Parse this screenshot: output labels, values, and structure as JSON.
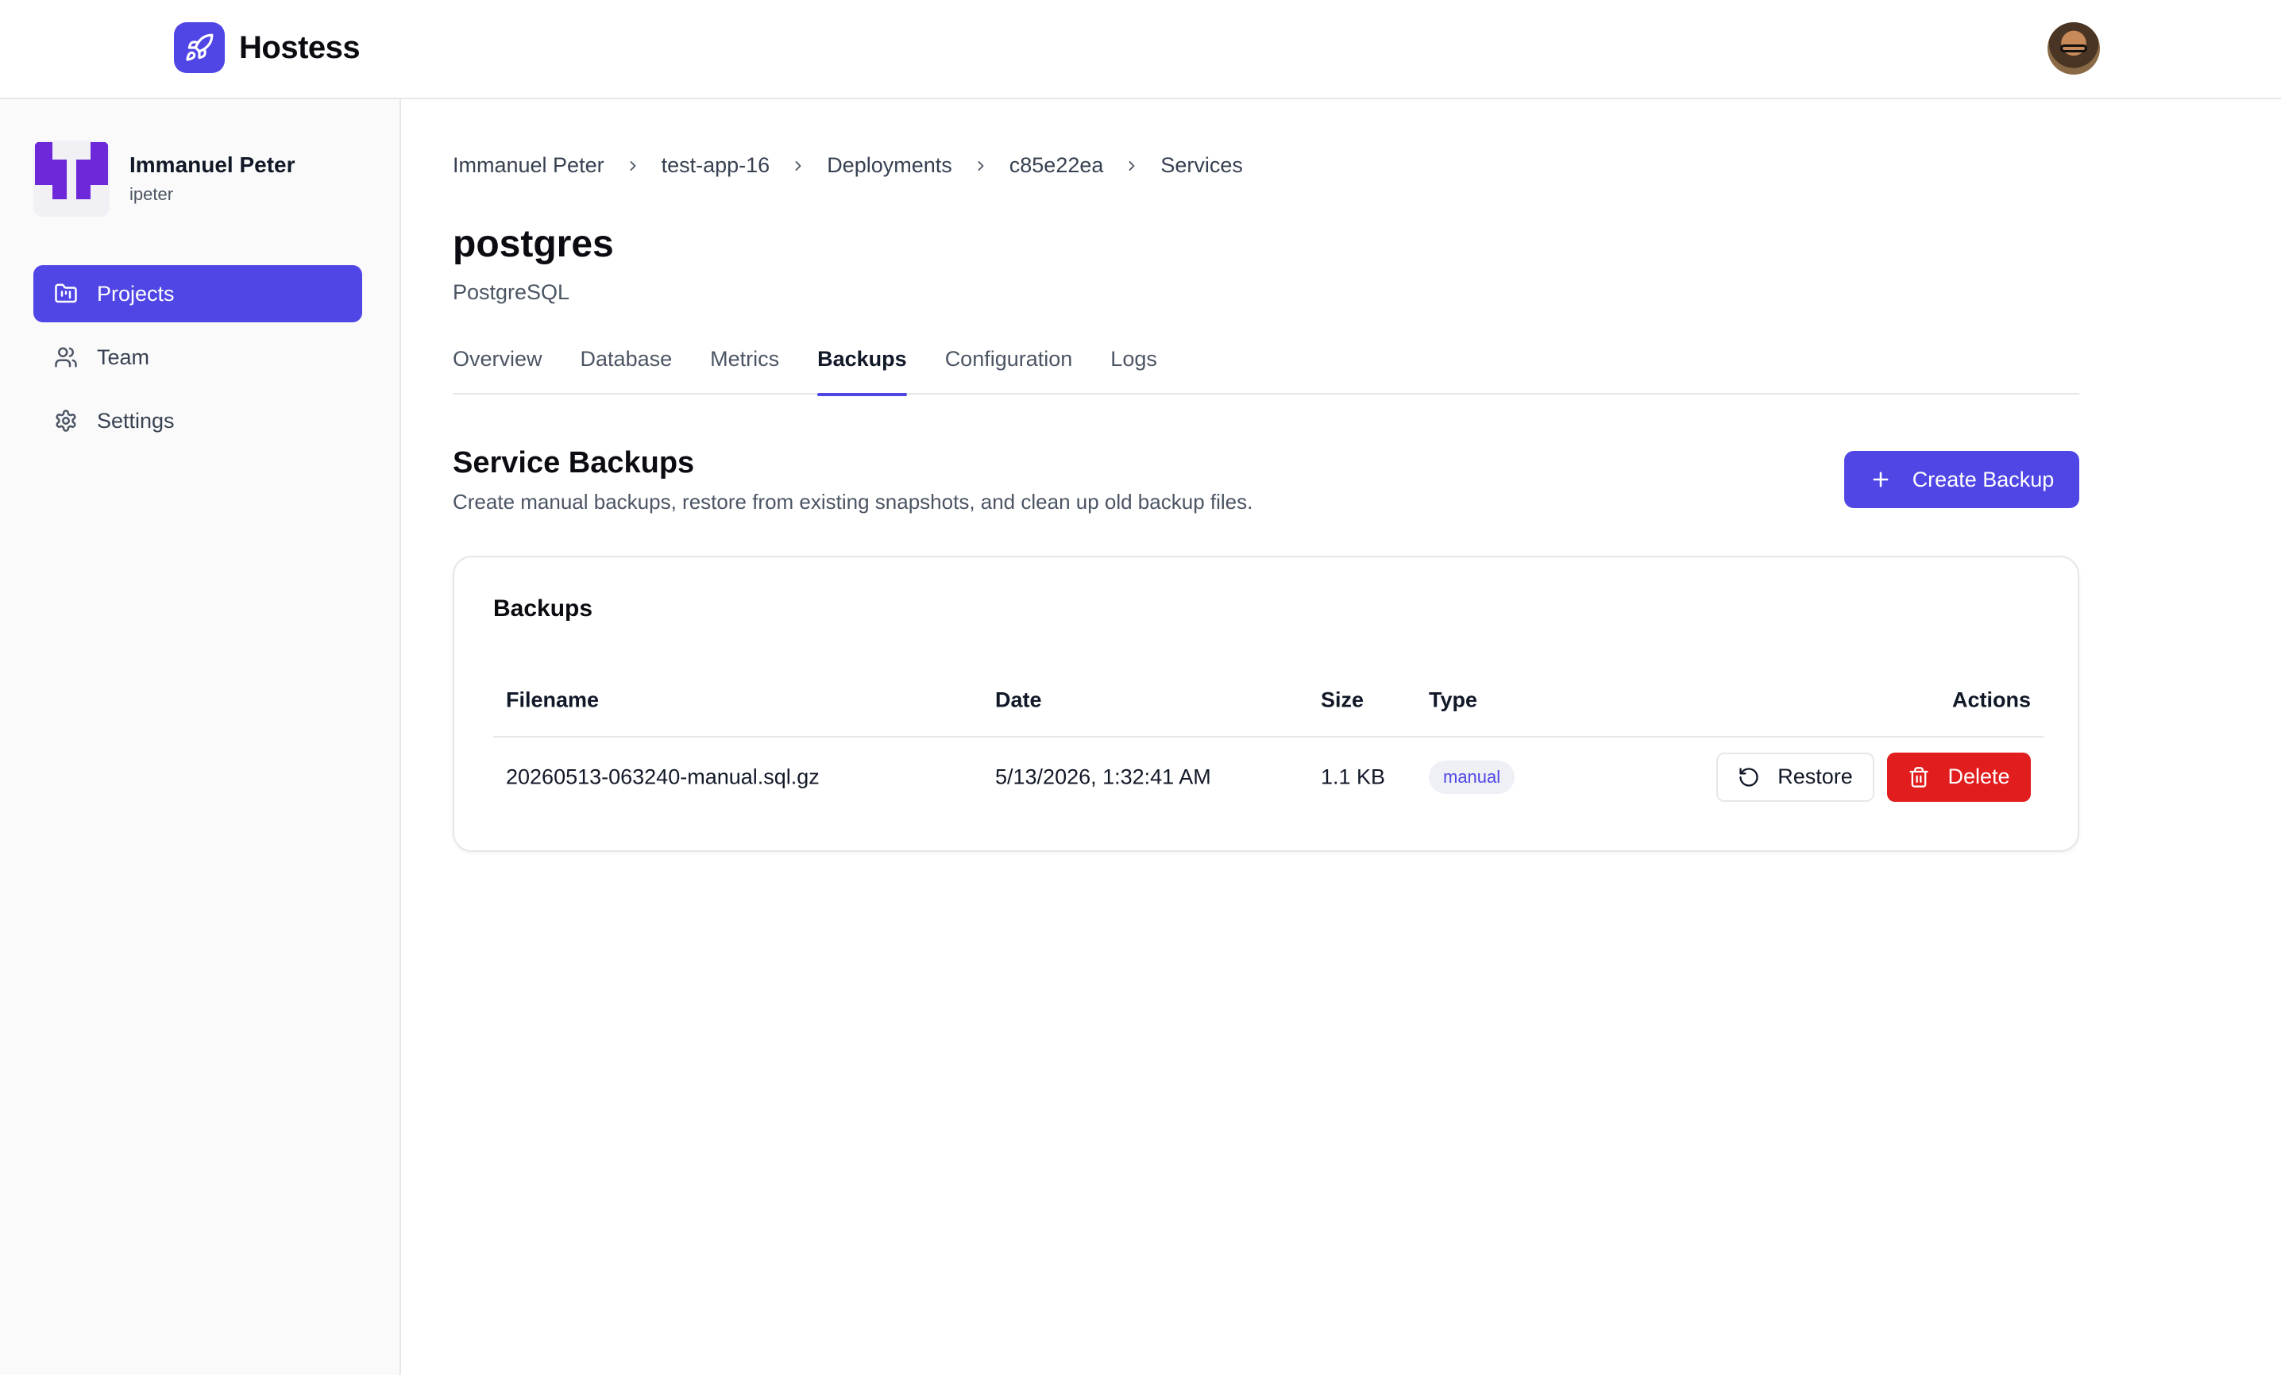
{
  "app": {
    "name": "Hostess"
  },
  "user": {
    "name": "Immanuel Peter",
    "handle": "ipeter"
  },
  "sidebar": {
    "items": [
      {
        "label": "Projects",
        "icon": "folder-chart-icon",
        "active": true
      },
      {
        "label": "Team",
        "icon": "users-icon",
        "active": false
      },
      {
        "label": "Settings",
        "icon": "gear-icon",
        "active": false
      }
    ]
  },
  "breadcrumb": [
    "Immanuel Peter",
    "test-app-16",
    "Deployments",
    "c85e22ea",
    "Services"
  ],
  "service": {
    "name": "postgres",
    "type": "PostgreSQL"
  },
  "tabs": [
    "Overview",
    "Database",
    "Metrics",
    "Backups",
    "Configuration",
    "Logs"
  ],
  "active_tab": "Backups",
  "section": {
    "title": "Service Backups",
    "description": "Create manual backups, restore from existing snapshots, and clean up old backup files.",
    "create_button": "Create Backup"
  },
  "backups": {
    "title": "Backups",
    "columns": {
      "filename": "Filename",
      "date": "Date",
      "size": "Size",
      "type": "Type",
      "actions": "Actions"
    },
    "rows": [
      {
        "filename": "20260513-063240-manual.sql.gz",
        "date": "5/13/2026, 1:32:41 AM",
        "size": "1.1 KB",
        "type": "manual",
        "restore_label": "Restore",
        "delete_label": "Delete"
      }
    ]
  },
  "colors": {
    "accent": "#4f46e5",
    "danger": "#e11d1d"
  }
}
